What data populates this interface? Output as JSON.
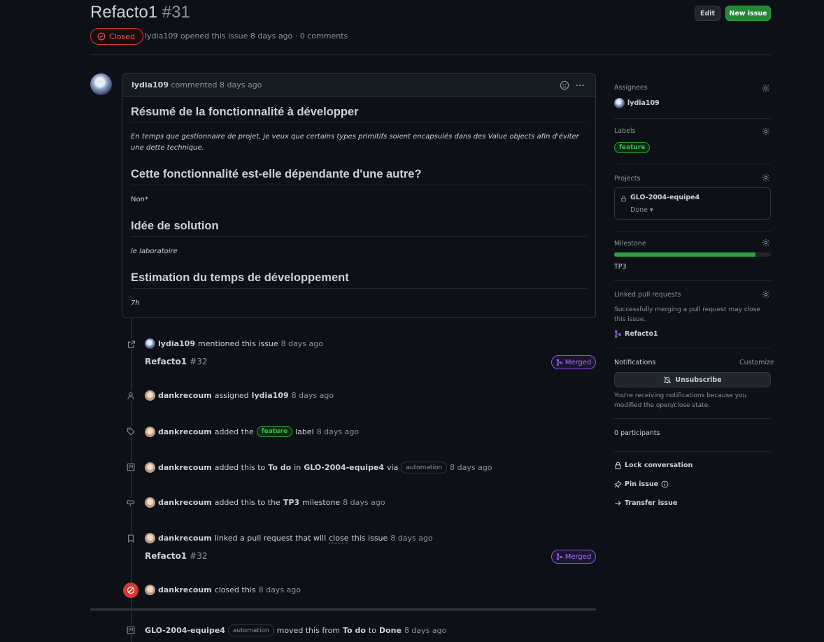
{
  "issue": {
    "title": "Refacto1",
    "number": "#31",
    "state": "Closed",
    "author": "lydia109",
    "opened_text": "opened this issue 8 days ago · 0 comments",
    "edit_label": "Edit",
    "new_issue_label": "New issue"
  },
  "comment": {
    "author": "lydia109",
    "meta": "commented 8 days ago",
    "sections": [
      {
        "heading": "Résumé de la fonctionnalité à développer",
        "body": "En temps que gestionnaire de projet, je veux que certains types primitifs soient encapsulés dans des Value objects afin d'éviter une dette technique."
      },
      {
        "heading": "Cette fonctionnalité est-elle dépendante d'une autre?",
        "body": "Non*"
      },
      {
        "heading": "Idée de solution",
        "body": "le laboratoire"
      },
      {
        "heading": "Estimation du temps de développement",
        "body": "7h"
      }
    ]
  },
  "timeline": {
    "mention": {
      "user": "lydia109",
      "text": "mentioned this issue",
      "time": "8 days ago",
      "pr_title": "Refacto1",
      "pr_num": "#32",
      "badge": "Merged"
    },
    "assigned": {
      "user": "dankrecoum",
      "text": "assigned",
      "target": "lydia109",
      "time": "8 days ago"
    },
    "labeled": {
      "user": "dankrecoum",
      "text1": "added the",
      "label": "feature",
      "text2": "label",
      "time": "8 days ago"
    },
    "project": {
      "user": "dankrecoum",
      "text1": "added this to",
      "column": "To do",
      "text2": "in",
      "project": "GLO-2004-equipe4",
      "text3": "via",
      "via": "automation",
      "time": "8 days ago"
    },
    "milestone": {
      "user": "dankrecoum",
      "text1": "added this to the",
      "milestone": "TP3",
      "text2": "milestone",
      "time": "8 days ago"
    },
    "linked": {
      "user": "dankrecoum",
      "text1": "linked a pull request that will",
      "close": "close",
      "text2": "this issue",
      "time": "8 days ago",
      "pr_title": "Refacto1",
      "pr_num": "#32",
      "badge": "Merged"
    },
    "closed": {
      "user": "dankrecoum",
      "text": "closed this",
      "time": "8 days ago"
    },
    "moved": {
      "project": "GLO-2004-equipe4",
      "via": "automation",
      "text1": "moved this from",
      "from": "To do",
      "text2": "to",
      "to": "Done",
      "time": "8 days ago"
    }
  },
  "sidebar": {
    "assignees_label": "Assignees",
    "assignee": "lydia109",
    "labels_label": "Labels",
    "label": "feature",
    "projects_label": "Projects",
    "project_name": "GLO-2004-equipe4",
    "project_status": "Done",
    "milestone_label": "Milestone",
    "milestone_progress": 0.9,
    "milestone_name": "TP3",
    "linked_label": "Linked pull requests",
    "linked_desc": "Successfully merging a pull request may close this issue.",
    "linked_pr": "Refacto1",
    "notifications_label": "Notifications",
    "customize_label": "Customize",
    "unsubscribe_label": "Unsubscribe",
    "notif_desc": "You're receiving notifications because you modified the open/close state.",
    "participants": "0 participants",
    "lock_label": "Lock conversation",
    "pin_label": "Pin issue",
    "transfer_label": "Transfer issue"
  },
  "colors": {
    "accent_green": "#238636",
    "closed_red": "#da3633",
    "merged_purple": "#8957e5"
  }
}
